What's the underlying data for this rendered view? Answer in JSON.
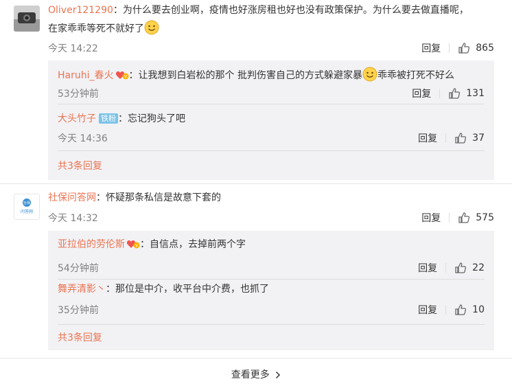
{
  "comments": [
    {
      "author": "Oliver121290",
      "text_a": "：为什么要去创业啊，疫情也好涨房租也好也没有政策保护。为什么要去做直播呢，",
      "text_b": "在家乖乖等死不就好了",
      "time": "今天 14:22",
      "reply_label": "回复",
      "likes": "865",
      "replies": [
        {
          "author": "Haruhi_春火",
          "text_a": "：让我想到白岩松的那个 批判伤害自己的方式躲避家暴",
          "text_b": "乖乖被打死不好么",
          "time": "53分钟前",
          "reply_label": "回复",
          "likes": "131"
        },
        {
          "author": "大头竹子",
          "badge": "铁粉",
          "text": "：忘记狗头了吧",
          "time": "今天 14:36",
          "reply_label": "回复",
          "likes": "37"
        }
      ],
      "more_replies": "共3条回复"
    },
    {
      "author": "社保问答网",
      "avatar_text_top": "社保",
      "avatar_text_bottom": "问答网",
      "text": "：怀疑那条私信是故意下套的",
      "time": "今天 14:32",
      "reply_label": "回复",
      "likes": "575",
      "replies": [
        {
          "author": "亚拉伯的劳伦斯",
          "text": "：自信点，去掉前两个字",
          "time": "54分钟前",
          "reply_label": "回复",
          "likes": "22"
        },
        {
          "author": "舞弄清影丶",
          "text": "：那位是中介，收平台中介费，也抓了",
          "time": "35分钟前",
          "reply_label": "回复",
          "likes": "10"
        }
      ],
      "more_replies": "共3条回复"
    }
  ],
  "see_more": "查看更多",
  "colors": {
    "name": "#eb7350",
    "reply_bg": "#f2f2f5",
    "badge": "#7cc3e8"
  }
}
